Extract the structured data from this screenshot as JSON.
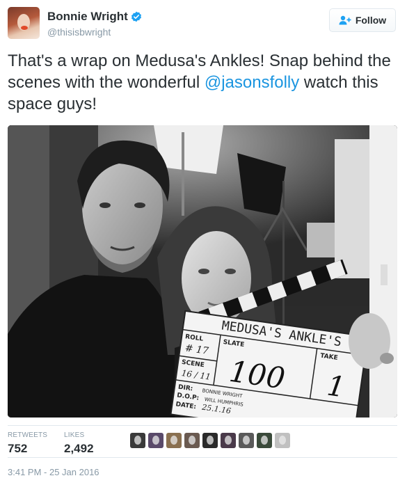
{
  "user": {
    "display_name": "Bonnie Wright",
    "handle": "@thisisbwright",
    "verified": true
  },
  "follow_button": {
    "label": "Follow"
  },
  "tweet": {
    "text_before": "That's a wrap on Medusa's Ankles! Snap behind the scenes with the wonderful ",
    "mention": "@jasonsfolly",
    "text_after": " watch this space guys!"
  },
  "photo": {
    "clapper": {
      "title": "MEDUSA'S ANKLE'S",
      "roll_label": "ROLL",
      "roll_value": "# 17",
      "slate_label": "SLATE",
      "slate_value": "100",
      "scene_label": "SCENE",
      "scene_value": "16 / 11",
      "take_label": "TAKE",
      "take_value": "1",
      "dir_label": "DIR:",
      "dir_value": "BONNIE WRIGHT",
      "dop_label": "D.O.P:",
      "dop_value": "WILL HUMPHRIS",
      "date_label": "DATE:",
      "date_value": "25.1.16"
    }
  },
  "stats": {
    "retweets_label": "RETWEETS",
    "retweets_value": "752",
    "likes_label": "LIKES",
    "likes_value": "2,492"
  },
  "likers": [
    "#3a3a3a",
    "#5a4a6a",
    "#8a7050",
    "#6a5a50",
    "#2a2a2a",
    "#4a3a4a",
    "#5a5a5a",
    "#3a4a3a",
    "#c0c0c0"
  ],
  "timestamp": "3:41 PM - 25 Jan 2016",
  "colors": {
    "link": "#1b95e0",
    "verified": "#1da1f2",
    "muted": "#8899a6"
  }
}
